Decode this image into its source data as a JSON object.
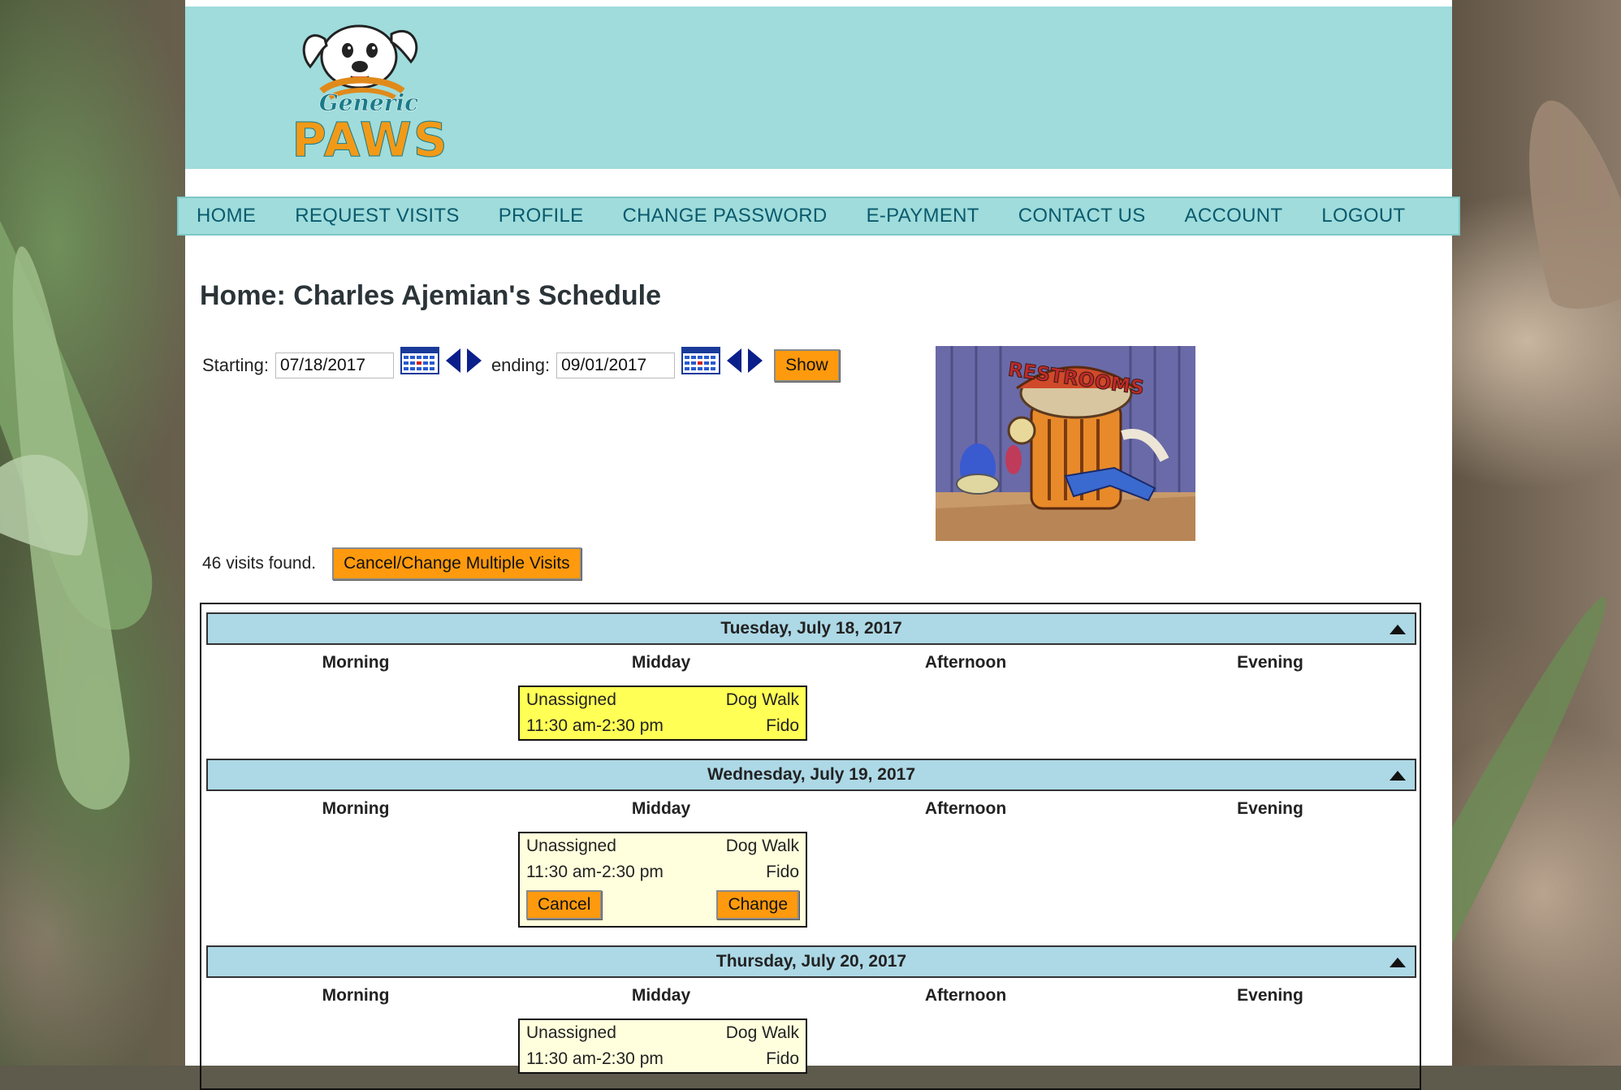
{
  "logo": {
    "line1": "Generic",
    "line2": "PAWS"
  },
  "nav": [
    "HOME",
    "REQUEST VISITS",
    "PROFILE",
    "CHANGE PASSWORD",
    "E-PAYMENT",
    "CONTACT US",
    "ACCOUNT",
    "LOGOUT"
  ],
  "page_title": "Home: Charles Ajemian's Schedule",
  "range": {
    "start_label": "Starting:",
    "start_value": "07/18/2017",
    "end_label": "ending:",
    "end_value": "09/01/2017",
    "show_label": "Show"
  },
  "photo_sign": "RESTROOMS",
  "visits_found": "46 visits found.",
  "multi_button": "Cancel/Change Multiple Visits",
  "slot_labels": [
    "Morning",
    "Midday",
    "Afternoon",
    "Evening"
  ],
  "days": [
    {
      "date": "Tuesday, July 18, 2017",
      "visit": {
        "walker": "Unassigned",
        "service": "Dog Walk",
        "time": "11:30 am-2:30 pm",
        "pet": "Fido",
        "highlight": "yellow",
        "cancel": "",
        "change": ""
      }
    },
    {
      "date": "Wednesday, July 19, 2017",
      "visit": {
        "walker": "Unassigned",
        "service": "Dog Walk",
        "time": "11:30 am-2:30 pm",
        "pet": "Fido",
        "highlight": "cream",
        "cancel": "Cancel",
        "change": "Change"
      }
    },
    {
      "date": "Thursday, July 20, 2017",
      "visit": {
        "walker": "Unassigned",
        "service": "Dog Walk",
        "time": "11:30 am-2:30 pm",
        "pet": "Fido",
        "highlight": "cream",
        "cancel": "",
        "change": ""
      }
    }
  ],
  "colors": {
    "header": "#9fdcdb",
    "nav_text": "#0a5a6e",
    "button": "#ff9a0e",
    "day_bar": "#add8e6",
    "visit_today": "#ffff55",
    "visit_other": "#ffffdd"
  }
}
